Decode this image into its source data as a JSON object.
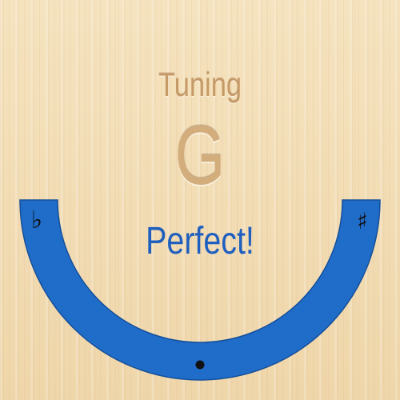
{
  "header": {
    "title": "Tuning"
  },
  "tuner": {
    "note": "G",
    "status": "Perfect!",
    "flat_symbol": "♭",
    "sharp_symbol": "♯",
    "accuracy": 0
  },
  "colors": {
    "meter": "#1f6cc9",
    "status_text": "#1f5fbf",
    "wood": "#f2dcb3"
  },
  "icons": [
    "flat-icon",
    "sharp-icon",
    "indicator-dot-icon"
  ]
}
